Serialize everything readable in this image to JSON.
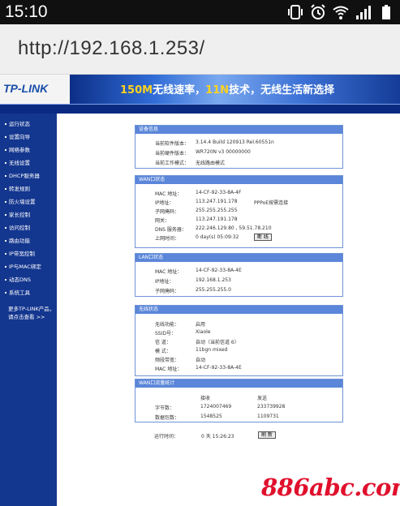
{
  "statusbar": {
    "time": "15:10",
    "icons": [
      "vibrate-icon",
      "alarm-icon",
      "wifi-icon",
      "signal-icon",
      "battery-icon"
    ]
  },
  "browser": {
    "url": "http://192.168.1.253/"
  },
  "banner": {
    "logo": "TP-LINK",
    "slogan_parts": [
      "150M",
      "无线速率，",
      "11N",
      "技术，无线生活新选择"
    ]
  },
  "menu": {
    "items": [
      "运行状态",
      "设置向导",
      "网络参数",
      "无线设置",
      "DHCP服务器",
      "转发规则",
      "防火墙设置",
      "家长控制",
      "访问控制",
      "路由功能",
      "IP带宽控制",
      "IP与MAC绑定",
      "动态DNS",
      "系统工具"
    ],
    "more_line1": "更多TP-LINK产品，",
    "more_line2": "请点击查看 >>"
  },
  "device": {
    "title": "设备信息",
    "rows": [
      {
        "label": "当前软件版本：",
        "value": "3.14.4 Build 120913 Rel.60551n"
      },
      {
        "label": "当前硬件版本：",
        "value": "WR720N v3 00000000"
      },
      {
        "label": "当前工作模式：",
        "value": "无线路由模式"
      }
    ]
  },
  "wan": {
    "title": "WAN口状态",
    "mac_label": "MAC 地址：",
    "mac": "14-CF-92-33-8A-4F",
    "ip_label": "IP地址：",
    "ip": "113.247.191.178",
    "ip_note": "PPPoE按需连接",
    "mask_label": "子网掩码：",
    "mask": "255.255.255.255",
    "gw_label": "网关：",
    "gw": "113.247.191.178",
    "dns_label": "DNS 服务器：",
    "dns": "222.246.129.80 , 59.51.78.210",
    "uptime_label": "上网时间：",
    "uptime": "0 day(s) 05:09:32",
    "disconnect_label": "断 线"
  },
  "lan": {
    "title": "LAN口状态",
    "rows": [
      {
        "label": "MAC 地址：",
        "value": "14-CF-92-33-8A-4E"
      },
      {
        "label": "IP地址：",
        "value": "192.168.1.253"
      },
      {
        "label": "子网掩码：",
        "value": "255.255.255.0"
      }
    ]
  },
  "wireless": {
    "title": "无线状态",
    "rows": [
      {
        "label": "无线功能：",
        "value": "启用"
      },
      {
        "label": "SSID号：",
        "value": "Xiaole"
      },
      {
        "label": "信 道：",
        "value": "自动（当前信道 6）"
      },
      {
        "label": "模 式：",
        "value": "11bgn mixed"
      },
      {
        "label": "频段带宽：",
        "value": "自动"
      },
      {
        "label": "MAC 地址：",
        "value": "14-CF-92-33-8A-4E"
      }
    ]
  },
  "traffic": {
    "title": "WAN口流量统计",
    "col_recv": "接收",
    "col_send": "发送",
    "bytes_label": "字节数：",
    "bytes_recv": "1724007469",
    "bytes_send": "233739928",
    "pkts_label": "数据包数：",
    "pkts_recv": "1548525",
    "pkts_send": "1109731"
  },
  "runtime": {
    "label": "运行时间：",
    "value": "0 天 15:26:23",
    "refresh_label": "刷 新"
  },
  "watermark": "886abc.com"
}
